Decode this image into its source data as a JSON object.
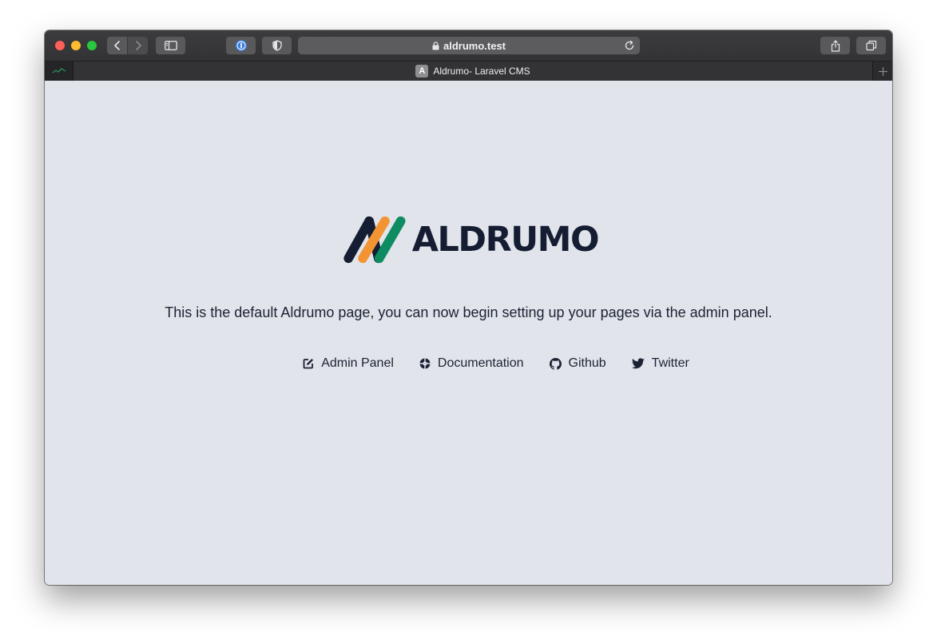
{
  "browser": {
    "address_text": "aldrumo.test",
    "tab_title": "Aldrumo- Laravel CMS",
    "tab_favicon_letter": "A"
  },
  "page": {
    "logo_text": "ALDRUMO",
    "tagline": "This is the default Aldrumo page, you can now begin setting up your pages via the admin panel.",
    "links": [
      {
        "label": "Admin Panel",
        "icon": "edit-icon"
      },
      {
        "label": "Documentation",
        "icon": "lifebuoy-icon"
      },
      {
        "label": "Github",
        "icon": "github-icon"
      },
      {
        "label": "Twitter",
        "icon": "twitter-icon"
      }
    ]
  },
  "colors": {
    "page_background": "#e1e4ea",
    "text_dark": "#151d33",
    "logo_orange": "#f39433",
    "logo_green": "#0d8b61"
  }
}
